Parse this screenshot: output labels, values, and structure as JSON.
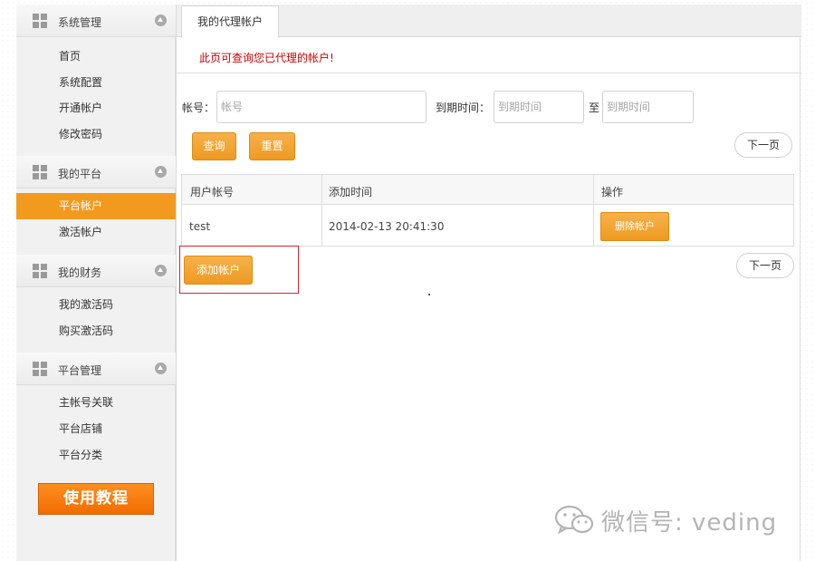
{
  "sidebar": {
    "sections": [
      {
        "title": "系统管理",
        "items": [
          "首页",
          "系统配置",
          "开通帐户",
          "修改密码"
        ]
      },
      {
        "title": "我的平台",
        "items": [
          "平台帐户",
          "激活帐户"
        ]
      },
      {
        "title": "我的财务",
        "items": [
          "我的激活码",
          "购买激活码"
        ]
      },
      {
        "title": "平台管理",
        "items": [
          "主帐号关联",
          "平台店铺",
          "平台分类"
        ]
      }
    ],
    "active_item": "平台帐户",
    "tutorial_button": "使用教程"
  },
  "main": {
    "tab_label": "我的代理帐户",
    "notice": "此页可查询您已代理的帐户!",
    "search": {
      "account_label": "帐号：",
      "account_placeholder": "帐号",
      "expiry_label": "到期时间：",
      "expiry_start_placeholder": "到期时间",
      "to_label": "至",
      "expiry_end_placeholder": "到期时间",
      "query_button": "查询",
      "reset_button": "重置"
    },
    "next_page": "下一页",
    "table": {
      "headers": [
        "用户帐号",
        "添加时间",
        "操作"
      ],
      "rows": [
        {
          "account": "test",
          "added": "2014-02-13 20:41:30",
          "action": "删除帐户"
        }
      ]
    },
    "add_account_button": "添加帐户"
  },
  "watermark": {
    "text": "微信号: veding"
  },
  "colors": {
    "accent": "#f29a1e",
    "notice": "#d00000",
    "highlight_box": "#d8242f",
    "tutorial": "#f07400"
  }
}
